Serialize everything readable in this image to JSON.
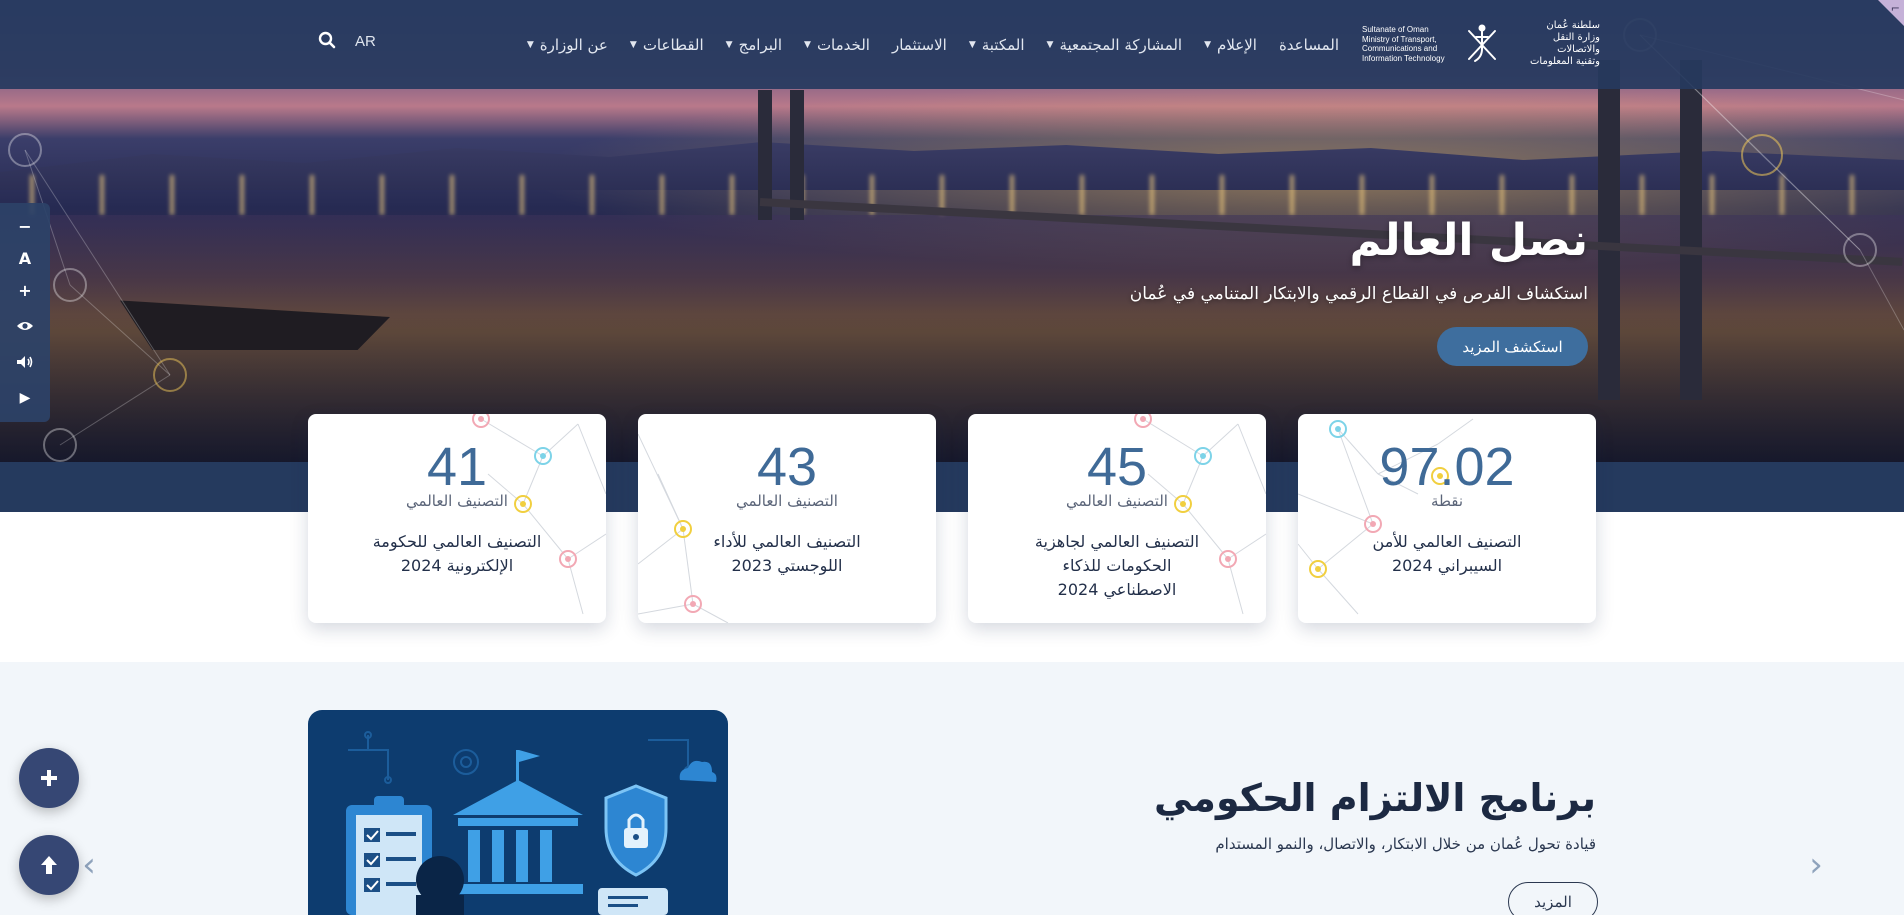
{
  "header": {
    "logo": {
      "arabic_lines": [
        "سلطنة عُمان",
        "وزارة النقل والاتصالات",
        "وتقنية المعلومات"
      ],
      "english_lines": [
        "Sultanate of Oman",
        "Ministry of Transport,",
        "Communications and",
        "Information Technology"
      ]
    },
    "nav": [
      {
        "label": "عن الوزارة",
        "dropdown": true
      },
      {
        "label": "القطاعات",
        "dropdown": true
      },
      {
        "label": "البرامج",
        "dropdown": true
      },
      {
        "label": "الخدمات",
        "dropdown": true
      },
      {
        "label": "الاستثمار",
        "dropdown": false
      },
      {
        "label": "المكتبة",
        "dropdown": true
      },
      {
        "label": "المشاركة المجتمعية",
        "dropdown": true
      },
      {
        "label": "الإعلام",
        "dropdown": true
      },
      {
        "label": "المساعدة",
        "dropdown": false
      }
    ],
    "language": "AR",
    "icons": {
      "search": "search-icon"
    }
  },
  "accessibility_toolbar": {
    "buttons": [
      {
        "name": "decrease-font-button",
        "glyph": "−"
      },
      {
        "name": "reset-font-button",
        "glyph": "A"
      },
      {
        "name": "increase-font-button",
        "glyph": "+"
      },
      {
        "name": "contrast-button",
        "glyph": "eye"
      },
      {
        "name": "audio-button",
        "glyph": "speaker"
      },
      {
        "name": "play-button",
        "glyph": "▶"
      }
    ]
  },
  "hero": {
    "title": "نصل العالم",
    "subtitle": "استكشاف الفرص في القطاع الرقمي والابتكار المتنامي في عُمان",
    "cta_label": "استكشف المزيد"
  },
  "stats": [
    {
      "value": "97.02",
      "unit": "نقطة",
      "description": "التصنيف العالمي للأمن السيبراني 2024"
    },
    {
      "value": "45",
      "unit": "التصنيف العالمي",
      "description": "التصنيف العالمي لجاهزية الحكومات للذكاء الاصطناعي 2024"
    },
    {
      "value": "43",
      "unit": "التصنيف العالمي",
      "description": "التصنيف العالمي للأداء اللوجستي 2023"
    },
    {
      "value": "41",
      "unit": "التصنيف العالمي",
      "description": "التصنيف العالمي للحكومة الإلكترونية 2024"
    }
  ],
  "program": {
    "title": "برنامج الالتزام الحكومي",
    "subtitle": "قيادة تحول عُمان من خلال الابتكار، والاتصال، والنمو المستدام",
    "more_label": "المزيد"
  },
  "colors": {
    "navbar": "#263a5e",
    "accent": "#3e6e9e",
    "stat_number": "#3f6a97",
    "fab": "#364774"
  }
}
